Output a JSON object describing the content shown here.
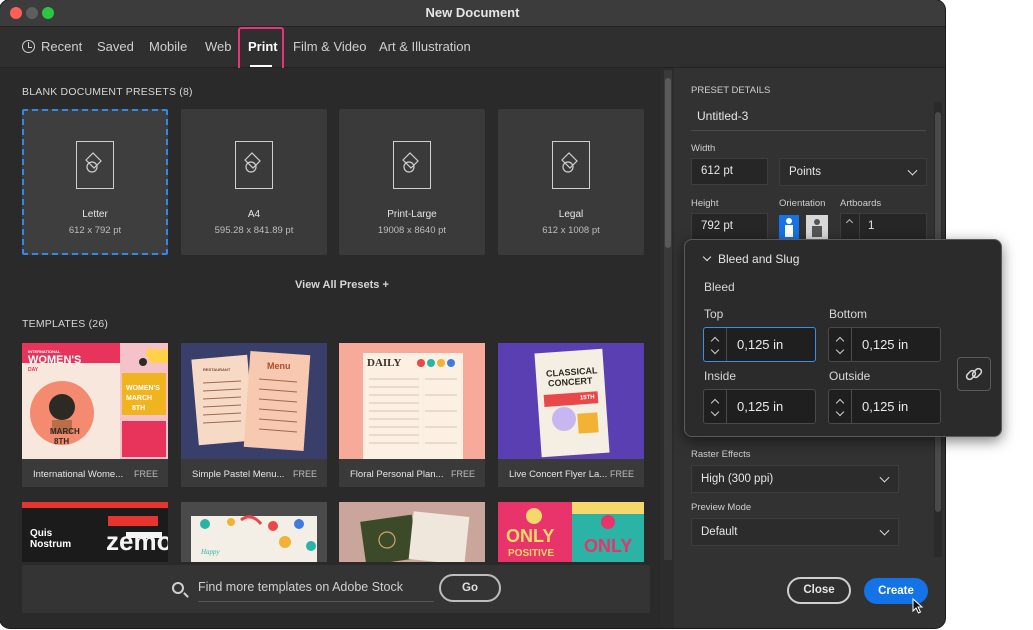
{
  "window": {
    "title": "New Document"
  },
  "tabs": [
    {
      "label": "Recent"
    },
    {
      "label": "Saved"
    },
    {
      "label": "Mobile"
    },
    {
      "label": "Web"
    },
    {
      "label": "Print"
    },
    {
      "label": "Film & Video"
    },
    {
      "label": "Art & Illustration"
    }
  ],
  "blank_presets": {
    "heading": "BLANK DOCUMENT PRESETS",
    "count": "(8)",
    "items": [
      {
        "name": "Letter",
        "size": "612 x 792 pt"
      },
      {
        "name": "A4",
        "size": "595.28 x 841.89 pt"
      },
      {
        "name": "Print-Large",
        "size": "19008 x 8640 pt"
      },
      {
        "name": "Legal",
        "size": "612 x 1008 pt"
      }
    ],
    "view_all": "View All Presets",
    "view_all_plus": "+"
  },
  "templates": {
    "heading": "TEMPLATES",
    "count": "(26)",
    "items": [
      {
        "name": "International Wome...",
        "badge": "FREE"
      },
      {
        "name": "Simple Pastel Menu...",
        "badge": "FREE"
      },
      {
        "name": "Floral Personal Plan...",
        "badge": "FREE"
      },
      {
        "name": "Live Concert Flyer La...",
        "badge": "FREE"
      }
    ],
    "thumb_text": {
      "womens_intl": "INTERNATIONAL",
      "womens": "WOMEN'S",
      "day": "DAY",
      "march": "MARCH",
      "eighth": "8TH",
      "menu": "Menu",
      "restaurant": "RESTAURANT",
      "daily": "DAILY",
      "classical": "CLASSICAL",
      "concert": "CONCERT",
      "date_num": "15TH",
      "quis": "Quis",
      "nostrum": "Nostrum",
      "zemo": "zemo",
      "happy": "Happy",
      "only": "ONLY",
      "positive": "POSITIVE"
    }
  },
  "search": {
    "placeholder": "Find more templates on Adobe Stock",
    "go": "Go"
  },
  "details": {
    "heading": "PRESET DETAILS",
    "name": "Untitled-3",
    "width_label": "Width",
    "width_value": "612 pt",
    "units": "Points",
    "height_label": "Height",
    "height_value": "792 pt",
    "orientation_label": "Orientation",
    "artboards_label": "Artboards",
    "artboards_value": "1",
    "raster_label": "Raster Effects",
    "raster_value": "High (300 ppi)",
    "preview_label": "Preview Mode",
    "preview_value": "Default"
  },
  "bleed": {
    "section": "Bleed and Slug",
    "label": "Bleed",
    "top_label": "Top",
    "top_value": "0,125 in",
    "bottom_label": "Bottom",
    "bottom_value": "0,125 in",
    "inside_label": "Inside",
    "inside_value": "0,125 in",
    "outside_label": "Outside",
    "outside_value": "0,125 in"
  },
  "actions": {
    "close": "Close",
    "create": "Create"
  },
  "colors": {
    "accent": "#1473e6",
    "highlight": "#e9337a",
    "selection": "#2d8ceb"
  }
}
